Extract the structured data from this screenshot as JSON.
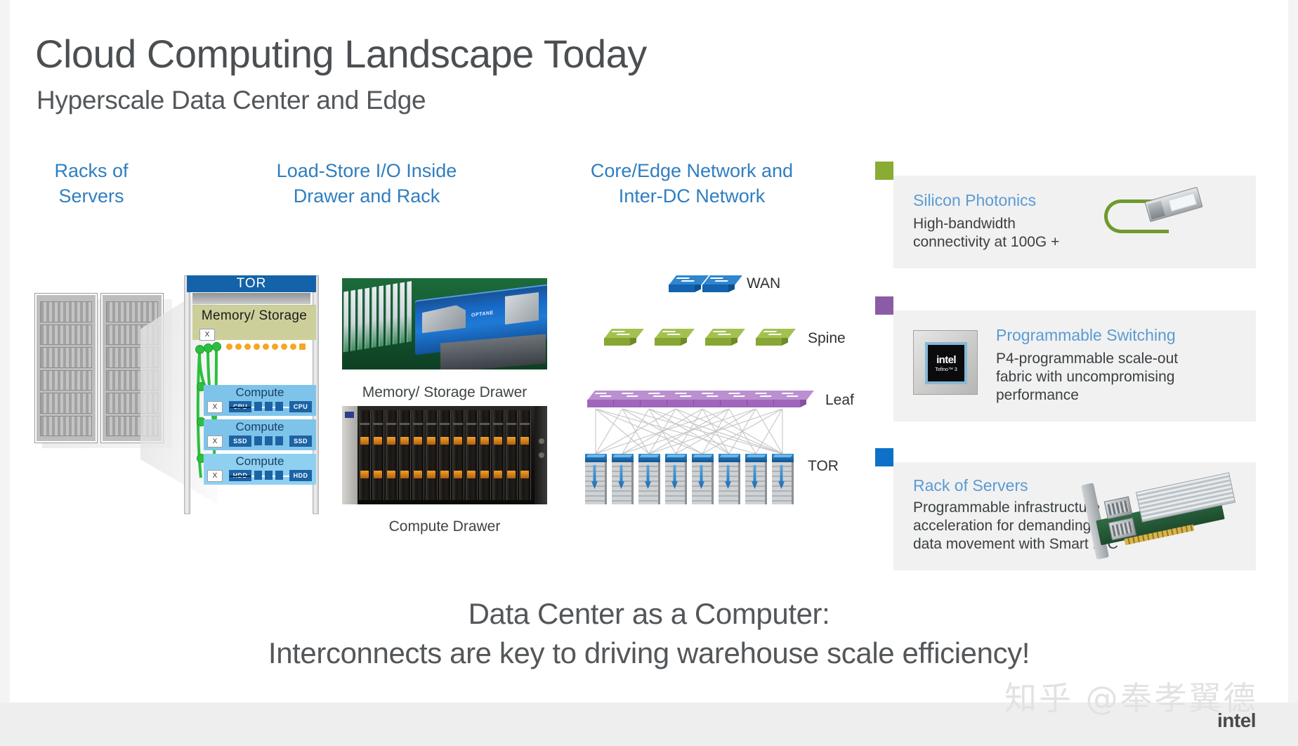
{
  "header": {
    "title": "Cloud Computing Landscape Today",
    "subtitle": "Hyperscale Data Center and Edge"
  },
  "columns": [
    {
      "label": "Racks of\nServers"
    },
    {
      "label": "Load-Store I/O Inside\nDrawer and Rack"
    },
    {
      "label": "Core/Edge Network and\nInter-DC Network"
    }
  ],
  "rack_diagram": {
    "tor_label": "TOR",
    "memory_shelf_label": "Memory/  Storage",
    "x_label": "X",
    "compute_shelves": [
      {
        "label": "Compute",
        "left_chip": "CPU",
        "right_chip": "CPU",
        "x_label": "X",
        "strike": true
      },
      {
        "label": "Compute",
        "left_chip": "SSD",
        "right_chip": "SSD",
        "x_label": "X",
        "strike": false
      },
      {
        "label": "Compute",
        "left_chip": "HDD",
        "right_chip": "HDD",
        "x_label": "X",
        "strike": true
      }
    ]
  },
  "drawers": [
    {
      "caption": "Memory/  Storage  Drawer"
    },
    {
      "caption": "Compute   Drawer"
    }
  ],
  "network": {
    "tiers": [
      {
        "label": "WAN",
        "count": 2,
        "color": "#1268b8"
      },
      {
        "label": "Spine",
        "count": 4,
        "color": "#8aab34"
      },
      {
        "label": "Leaf",
        "count": 8,
        "color": "#a76fc0"
      },
      {
        "label": "TOR",
        "count": 8,
        "color": "#1b6fb5"
      }
    ]
  },
  "cards": [
    {
      "marker_color": "#8aab34",
      "title": "Silicon Photonics",
      "body": "High-bandwidth\nconnectivity at 100G +",
      "image_name": "qsfp-transceiver-image"
    },
    {
      "marker_color": "#8c5ba6",
      "title": "Programmable Switching",
      "body": "P4-programmable scale-out\nfabric with uncompromising\nperformance",
      "image_name": "intel-tofino-chip-image",
      "chip_brand": "intel",
      "chip_model": "Tofino™ 3"
    },
    {
      "marker_color": "#0e70c8",
      "title": "Rack of Servers",
      "body": "Programmable infrastructure\nacceleration for demanding\ndata movement with Smart NIC",
      "image_name": "smart-nic-card-image"
    }
  ],
  "statement": "Data Center as a Computer:\nInterconnects are key to driving warehouse scale efficiency!",
  "footer": {
    "watermark": "知乎 @奉孝翼德",
    "logo": "intel"
  }
}
